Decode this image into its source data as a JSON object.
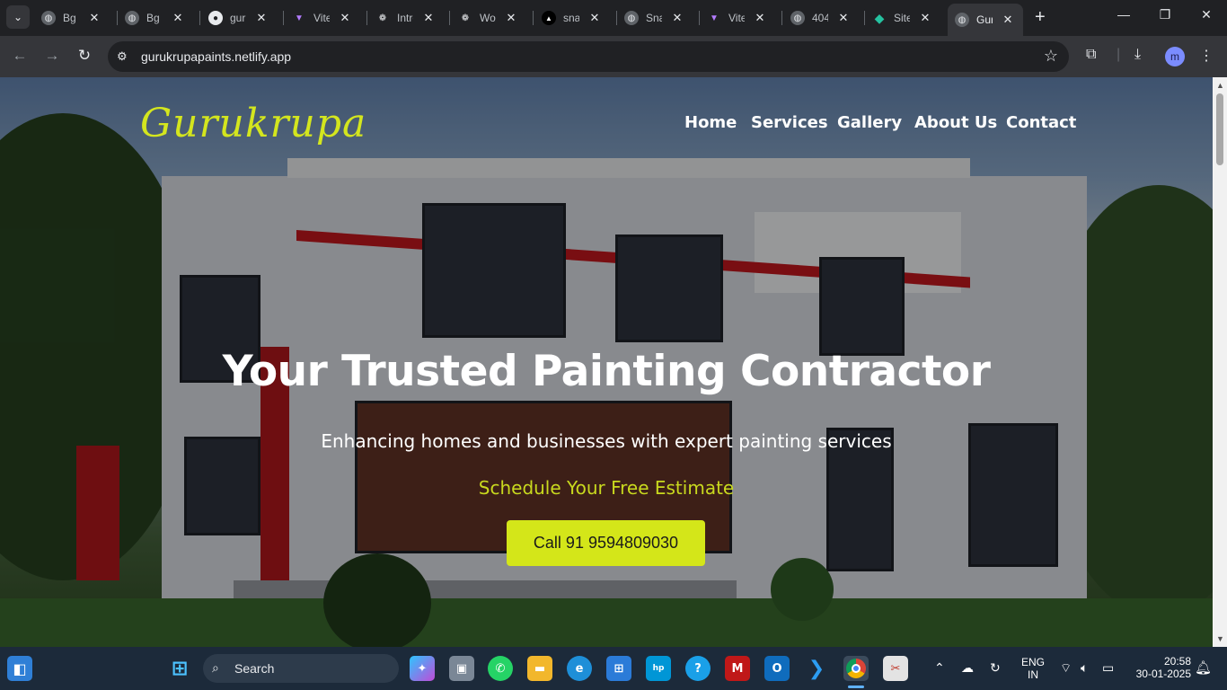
{
  "browser": {
    "tabs": [
      {
        "title": "Bg c",
        "icon": "globe-icon"
      },
      {
        "title": "Bg c",
        "icon": "globe-icon"
      },
      {
        "title": "guru",
        "icon": "github-icon"
      },
      {
        "title": "Vite",
        "icon": "vite-icon"
      },
      {
        "title": "Intro",
        "icon": "openai-icon"
      },
      {
        "title": "Wor",
        "icon": "openai-icon"
      },
      {
        "title": "snak",
        "icon": "triangle-icon"
      },
      {
        "title": "Snak",
        "icon": "globe-icon"
      },
      {
        "title": "Vite",
        "icon": "vite-icon"
      },
      {
        "title": "404",
        "icon": "globe-icon"
      },
      {
        "title": "Site",
        "icon": "netlify-icon"
      },
      {
        "title": "Guru",
        "icon": "globe-icon",
        "active": true
      }
    ],
    "url": "gurukrupapaints.netlify.app",
    "profile_initial": "m"
  },
  "site": {
    "logo": "Gurukrupa",
    "nav": [
      "Home",
      "Services",
      "Gallery",
      "About Us",
      "Contact"
    ],
    "headline": "Your Trusted Painting Contractor",
    "subheadline": "Enhancing homes and businesses with expert painting services",
    "cta_text": "Schedule Your Free Estimate",
    "call_button": "Call 91 9594809030",
    "colors": {
      "accent": "#d4e619",
      "cta_text": "#c9d91e"
    }
  },
  "taskbar": {
    "search_label": "Search",
    "language": "ENG",
    "region": "IN",
    "time": "20:58",
    "date": "30-01-2025"
  }
}
